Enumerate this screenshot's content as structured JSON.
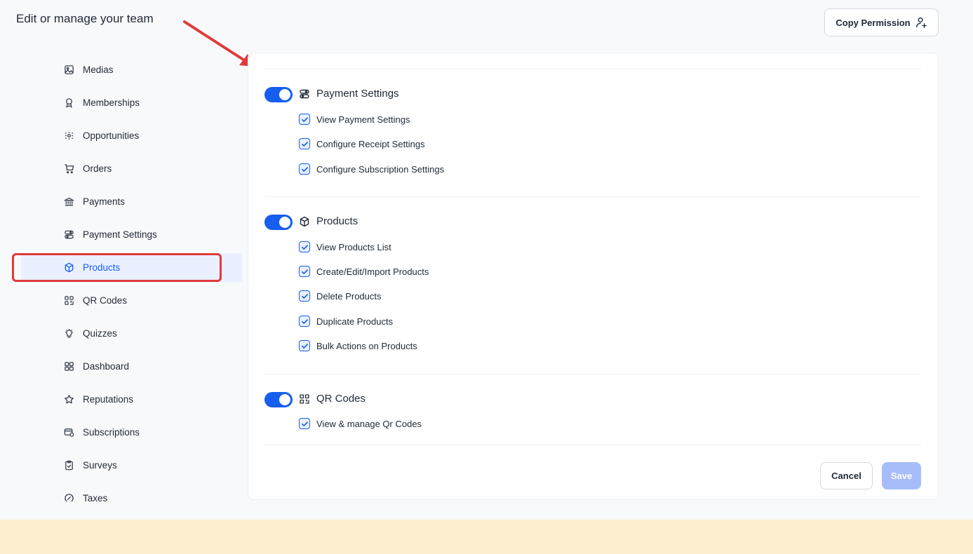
{
  "header": {
    "title": "Edit or manage your team",
    "copy_permission_label": "Copy Permission"
  },
  "sidebar": {
    "items": [
      {
        "label": "Medias",
        "icon": "image-icon"
      },
      {
        "label": "Memberships",
        "icon": "award-icon"
      },
      {
        "label": "Opportunities",
        "icon": "pipeline-icon"
      },
      {
        "label": "Orders",
        "icon": "cart-icon"
      },
      {
        "label": "Payments",
        "icon": "bank-icon"
      },
      {
        "label": "Payment Settings",
        "icon": "toggles-icon"
      },
      {
        "label": "Products",
        "icon": "box-icon",
        "active": true
      },
      {
        "label": "QR Codes",
        "icon": "qr-code-icon"
      },
      {
        "label": "Quizzes",
        "icon": "bulb-icon"
      },
      {
        "label": "Dashboard",
        "icon": "grid-icon"
      },
      {
        "label": "Reputations",
        "icon": "star-icon"
      },
      {
        "label": "Subscriptions",
        "icon": "subscription-icon"
      },
      {
        "label": "Surveys",
        "icon": "clipboard-icon"
      },
      {
        "label": "Taxes",
        "icon": "tax-icon"
      }
    ]
  },
  "sections": [
    {
      "title": "Payment Settings",
      "icon": "toggles-icon",
      "enabled": true,
      "permissions": [
        "View Payment Settings",
        "Configure Receipt Settings",
        "Configure Subscription Settings"
      ]
    },
    {
      "title": "Products",
      "icon": "box-icon",
      "enabled": true,
      "permissions": [
        "View Products List",
        "Create/Edit/Import Products",
        "Delete Products",
        "Duplicate Products",
        "Bulk Actions on Products"
      ]
    },
    {
      "title": "QR Codes",
      "icon": "qr-code-icon",
      "enabled": true,
      "permissions": [
        "View & manage Qr Codes"
      ]
    }
  ],
  "actions": {
    "cancel_label": "Cancel",
    "save_label": "Save"
  },
  "colors": {
    "accent": "#155eef",
    "annotation": "#e03a3a",
    "footer_band": "#fdf0d0"
  }
}
